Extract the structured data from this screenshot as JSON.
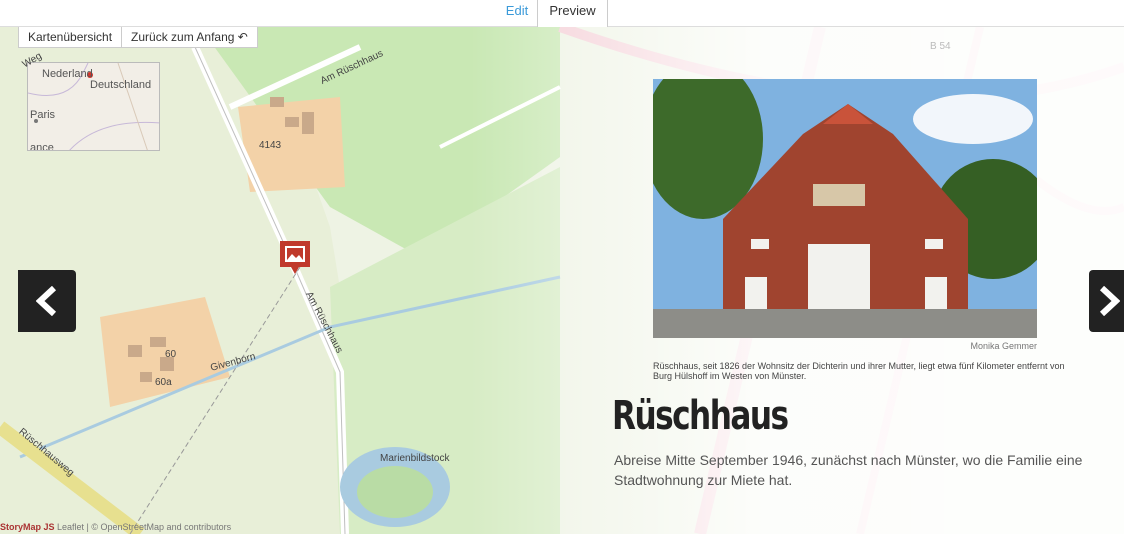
{
  "tabs": {
    "edit": "Edit",
    "preview": "Preview"
  },
  "map_buttons": {
    "overview": "Kartenübersicht",
    "back_to_start": "Zurück zum Anfang"
  },
  "overview_map": {
    "label_netherlands": "Nederland",
    "label_germany": "Deutschland",
    "label_paris": "Paris",
    "label_france": "ance"
  },
  "streets": {
    "am_rueschhaus_top": "Am Rüschhaus",
    "am_rueschhaus_side": "Am Rüschhaus",
    "weg": "Weg",
    "givenborn": "Givenborn",
    "rueschhausweg": "Rüschhausweg",
    "marienbildstock": "Marienbildstock",
    "b54": "B 54"
  },
  "house_numbers": [
    "41",
    "43",
    "60",
    "60a"
  ],
  "content": {
    "photo_credit": "Monika Gemmer",
    "caption": "Rüschhaus, seit 1826 der Wohnsitz der Dichterin und ihrer Mutter, liegt etwa fünf Kilometer entfernt von Burg Hülshoff im Westen von Münster.",
    "title": "Rüschhaus",
    "description": "Abreise Mitte September 1946, zunächst nach Münster, wo die Familie eine Stadtwohnung zur Miete hat."
  },
  "attribution": {
    "brand": "StoryMap JS",
    "text": "Leaflet | © OpenStreetMap and contributors"
  },
  "icons": {
    "prev": "chevron-left-icon",
    "next": "chevron-right-icon",
    "back": "back-arrow-icon",
    "marker": "image-marker-icon"
  },
  "colors": {
    "accent": "#3a9ad9",
    "marker": "#c0392b",
    "nav_bg": "#222222"
  }
}
